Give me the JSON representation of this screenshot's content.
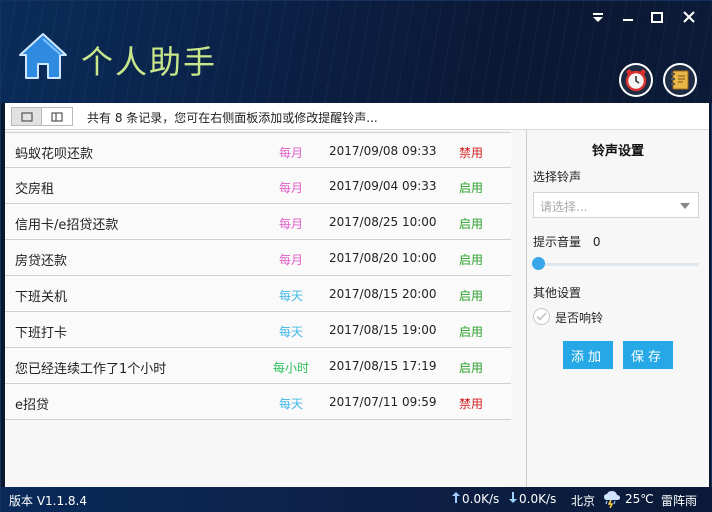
{
  "header": {
    "app_title": "个人助手",
    "title_color": "#c8e68a",
    "icons": [
      "home-icon",
      "menu-icon",
      "minimize-icon",
      "maximize-icon",
      "close-icon",
      "alarm-clock-icon",
      "notebook-icon"
    ]
  },
  "toolbar": {
    "message": "共有 8 条记录，您可在右侧面板添加或修改提醒铃声..."
  },
  "reminders": [
    {
      "name": "蚂蚁花呗还款",
      "freq": "每月",
      "time": "2017/09/08 09:33",
      "status": "禁用"
    },
    {
      "name": "交房租",
      "freq": "每月",
      "time": "2017/09/04 09:33",
      "status": "启用"
    },
    {
      "name": "信用卡/e招贷还款",
      "freq": "每月",
      "time": "2017/08/25 10:00",
      "status": "启用"
    },
    {
      "name": "房贷还款",
      "freq": "每月",
      "time": "2017/08/20 10:00",
      "status": "启用"
    },
    {
      "name": "下班关机",
      "freq": "每天",
      "time": "2017/08/15 20:00",
      "status": "启用"
    },
    {
      "name": "下班打卡",
      "freq": "每天",
      "time": "2017/08/15 19:00",
      "status": "启用"
    },
    {
      "name": "您已经连续工作了1个小时",
      "freq": "每小时",
      "time": "2017/08/15 17:19",
      "status": "启用"
    },
    {
      "name": "e招贷",
      "freq": "每天",
      "time": "2017/07/11 09:59",
      "status": "禁用"
    }
  ],
  "colors": {
    "freq_monthly": "#e060c8",
    "freq_daily": "#42b8e6",
    "freq_hourly": "#2ec05a",
    "status_enabled": "#2aa02a",
    "status_disabled": "#d42020",
    "button": "#27a8e6"
  },
  "settings": {
    "title": "铃声设置",
    "ringtone_label": "选择铃声",
    "ringtone_placeholder": "请选择...",
    "volume_label": "提示音量",
    "volume_value": "0",
    "volume_level": 0,
    "other_label": "其他设置",
    "ring_checkbox_label": "是否响铃",
    "ring_checked": false,
    "add_label": "添加",
    "save_label": "保存"
  },
  "statusbar": {
    "version": "版本 V1.1.8.4",
    "upload": "0.0K/s",
    "download": "0.0K/s",
    "city": "北京",
    "temperature": "25℃",
    "weather": "雷阵雨",
    "weather_icon": "thunderstorm-icon"
  }
}
